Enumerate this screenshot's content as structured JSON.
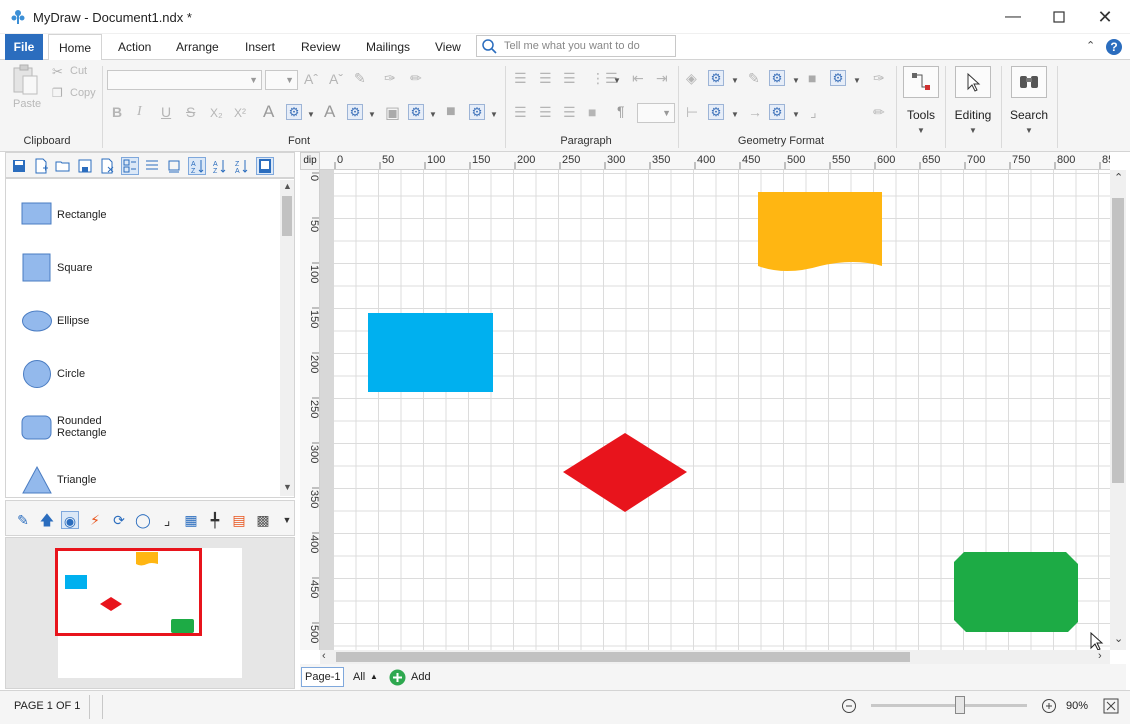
{
  "window": {
    "title": "MyDraw - Document1.ndx *",
    "controls": [
      "minimize-icon",
      "maximize-icon",
      "close-icon"
    ]
  },
  "ribbon_tabs": [
    {
      "label": "File"
    },
    {
      "label": "Home"
    },
    {
      "label": "Action"
    },
    {
      "label": "Arrange"
    },
    {
      "label": "Insert"
    },
    {
      "label": "Review"
    },
    {
      "label": "Mailings"
    },
    {
      "label": "View"
    }
  ],
  "tell_me": {
    "placeholder": "Tell me what you want to do"
  },
  "ribbon": {
    "clipboard": {
      "paste": "Paste",
      "cut": "Cut",
      "copy": "Copy",
      "group": "Clipboard"
    },
    "font": {
      "group": "Font"
    },
    "paragraph": {
      "group": "Paragraph",
      "pilcrow": "¶"
    },
    "geometry": {
      "group": "Geometry Format"
    },
    "tools": {
      "label": "Tools"
    },
    "editing": {
      "label": "Editing"
    },
    "search": {
      "label": "Search"
    }
  },
  "shapes": [
    {
      "label": "Rectangle",
      "kind": "rect"
    },
    {
      "label": "Square",
      "kind": "square"
    },
    {
      "label": "Ellipse",
      "kind": "ellipse"
    },
    {
      "label": "Circle",
      "kind": "circle"
    },
    {
      "label": "Rounded",
      "label2": "Rectangle",
      "kind": "rounded"
    },
    {
      "label": "Triangle",
      "kind": "triangle"
    }
  ],
  "ruler": {
    "unit": "dip",
    "top_ticks": [
      "0",
      "50",
      "100",
      "150",
      "200",
      "250",
      "300",
      "350",
      "400",
      "450",
      "500",
      "550",
      "600",
      "650",
      "700",
      "750",
      "800",
      "85"
    ],
    "left_ticks": [
      "0",
      "50",
      "100",
      "150",
      "200",
      "250",
      "300",
      "350",
      "400",
      "450",
      "500"
    ]
  },
  "colors": {
    "blue": "#00b0ef",
    "yellow": "#ffb612",
    "red": "#e8141c",
    "green": "#1dab45",
    "shape_fill": "#93b9ec",
    "shape_stroke": "#4a7cc2",
    "accent": "#2b6dbe"
  },
  "page_tabs": {
    "active": "Page-1",
    "all": "All",
    "add": "Add"
  },
  "status": {
    "page": "PAGE 1 OF 1",
    "zoom": "90%",
    "zoom_level": 0.9
  }
}
